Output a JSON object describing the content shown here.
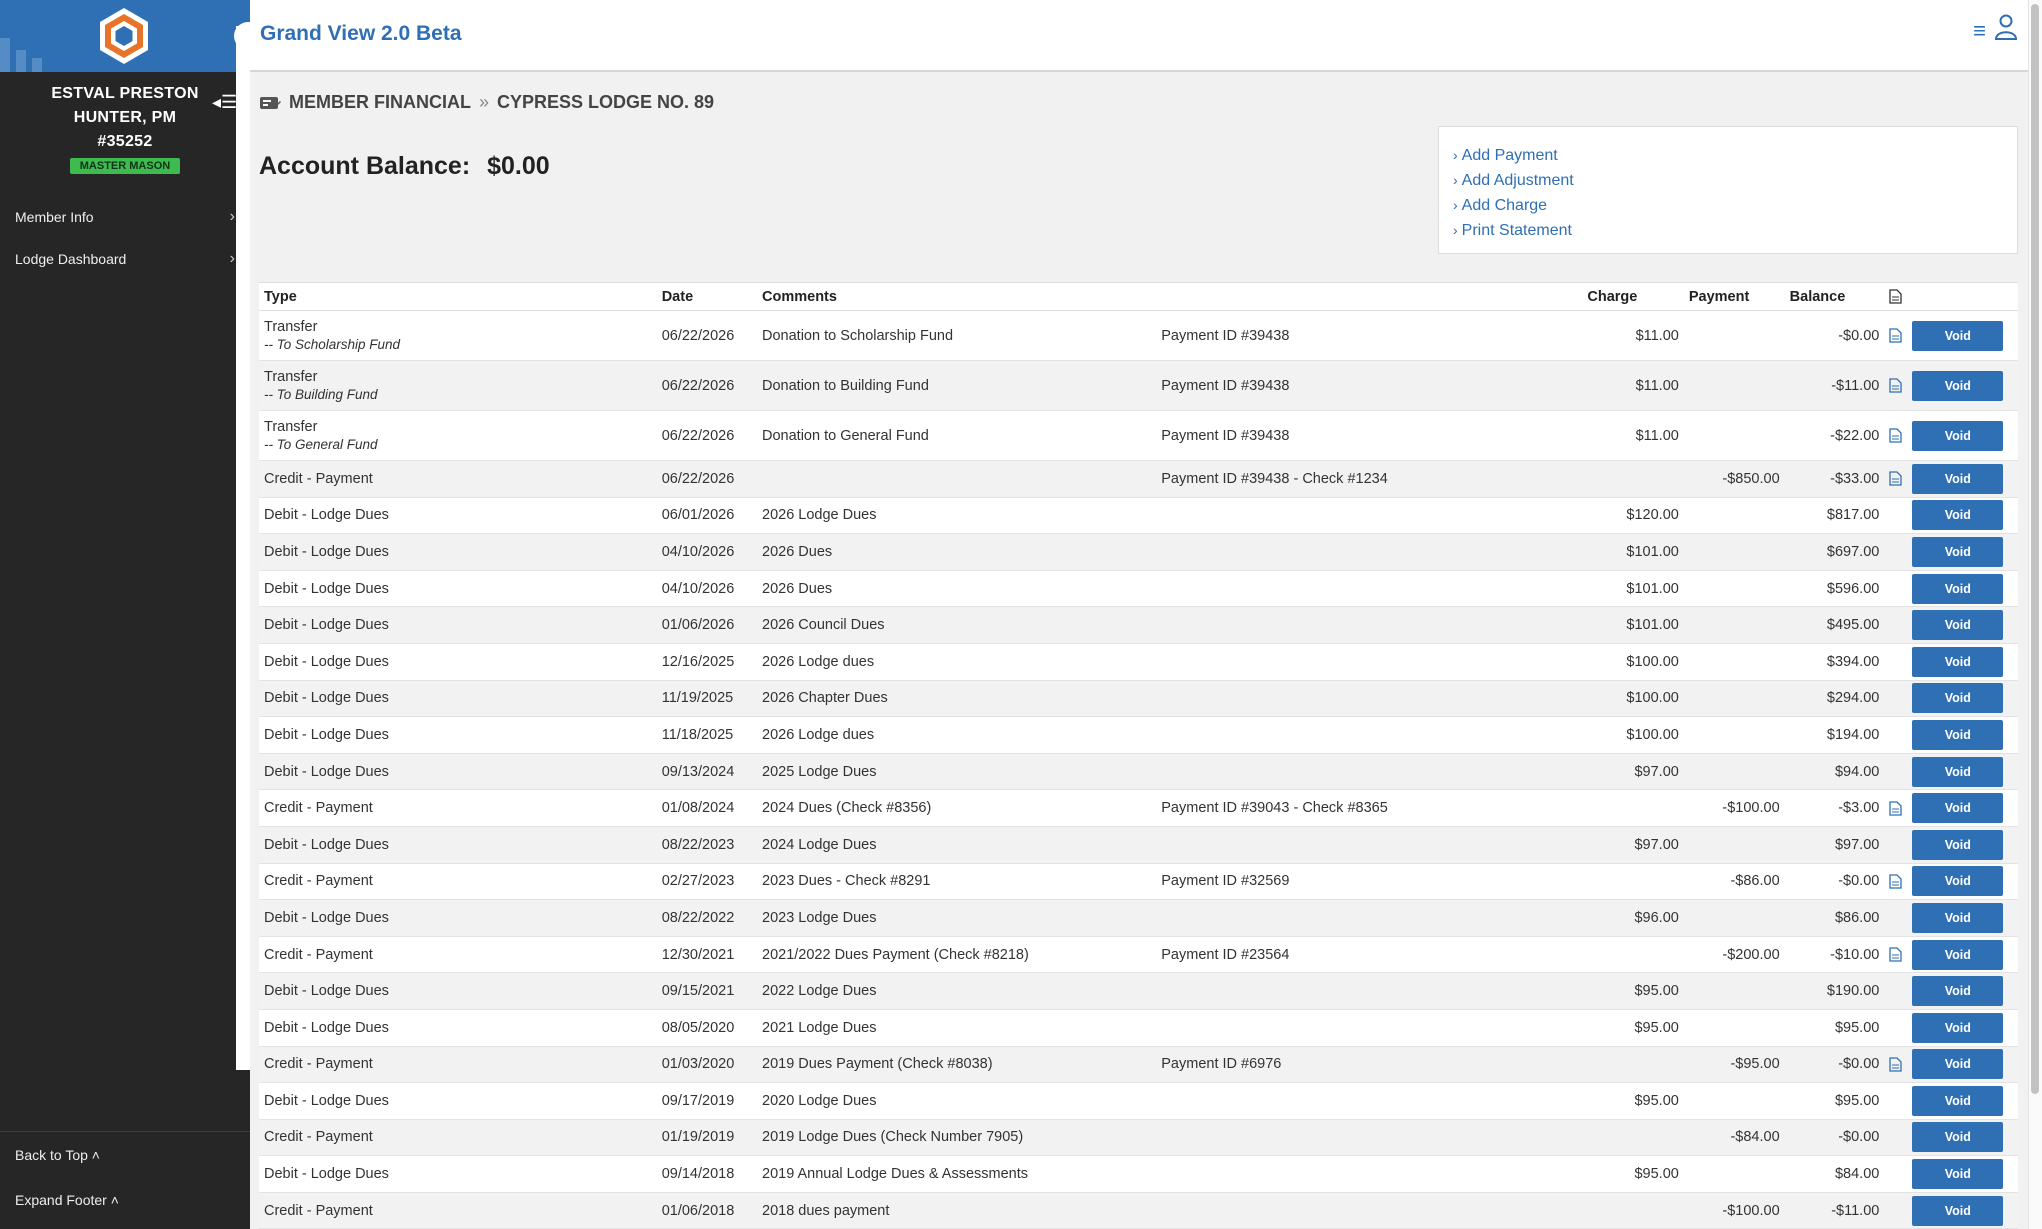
{
  "app": {
    "title": "Grand View 2.0 Beta"
  },
  "member": {
    "name_line1": "ESTVAL PRESTON",
    "name_line2": "HUNTER, PM",
    "id": "#35252",
    "badge": "MASTER MASON"
  },
  "sidebar": {
    "items": [
      {
        "label": "Member Info"
      },
      {
        "label": "Lodge Dashboard"
      }
    ],
    "footer": {
      "back_to_top": "Back to Top",
      "expand_footer": "Expand Footer"
    }
  },
  "breadcrumb": {
    "section": "MEMBER FINANCIAL",
    "lodge": "CYPRESS LODGE NO. 89"
  },
  "account": {
    "label": "Account Balance:",
    "amount": "$0.00"
  },
  "actions": {
    "add_payment": "Add Payment",
    "add_adjustment": "Add Adjustment",
    "add_charge": "Add Charge",
    "print_statement": "Print Statement"
  },
  "table": {
    "headers": {
      "type": "Type",
      "date": "Date",
      "comments": "Comments",
      "charge": "Charge",
      "payment": "Payment",
      "balance": "Balance"
    },
    "void_label": "Void",
    "rows": [
      {
        "type": "Transfer",
        "sub": "-- To Scholarship Fund",
        "date": "06/22/2026",
        "comment": "Donation to Scholarship Fund",
        "ref": "Payment ID #39438",
        "charge": "$11.00",
        "payment": "",
        "balance": "-$0.00",
        "doc": true
      },
      {
        "type": "Transfer",
        "sub": "-- To Building Fund",
        "date": "06/22/2026",
        "comment": "Donation to Building Fund",
        "ref": "Payment ID #39438",
        "charge": "$11.00",
        "payment": "",
        "balance": "-$11.00",
        "doc": true
      },
      {
        "type": "Transfer",
        "sub": "-- To General Fund",
        "date": "06/22/2026",
        "comment": "Donation to General Fund",
        "ref": "Payment ID #39438",
        "charge": "$11.00",
        "payment": "",
        "balance": "-$22.00",
        "doc": true
      },
      {
        "type": "Credit - Payment",
        "sub": "",
        "date": "06/22/2026",
        "comment": "",
        "ref": "Payment ID #39438 - Check #1234",
        "charge": "",
        "payment": "-$850.00",
        "balance": "-$33.00",
        "doc": true
      },
      {
        "type": "Debit - Lodge Dues",
        "sub": "",
        "date": "06/01/2026",
        "comment": "2026 Lodge Dues",
        "ref": "",
        "charge": "$120.00",
        "payment": "",
        "balance": "$817.00",
        "doc": false
      },
      {
        "type": "Debit - Lodge Dues",
        "sub": "",
        "date": "04/10/2026",
        "comment": "2026 Dues",
        "ref": "",
        "charge": "$101.00",
        "payment": "",
        "balance": "$697.00",
        "doc": false
      },
      {
        "type": "Debit - Lodge Dues",
        "sub": "",
        "date": "04/10/2026",
        "comment": "2026 Dues",
        "ref": "",
        "charge": "$101.00",
        "payment": "",
        "balance": "$596.00",
        "doc": false
      },
      {
        "type": "Debit - Lodge Dues",
        "sub": "",
        "date": "01/06/2026",
        "comment": "2026 Council Dues",
        "ref": "",
        "charge": "$101.00",
        "payment": "",
        "balance": "$495.00",
        "doc": false
      },
      {
        "type": "Debit - Lodge Dues",
        "sub": "",
        "date": "12/16/2025",
        "comment": "2026 Lodge dues",
        "ref": "",
        "charge": "$100.00",
        "payment": "",
        "balance": "$394.00",
        "doc": false
      },
      {
        "type": "Debit - Lodge Dues",
        "sub": "",
        "date": "11/19/2025",
        "comment": "2026 Chapter Dues",
        "ref": "",
        "charge": "$100.00",
        "payment": "",
        "balance": "$294.00",
        "doc": false
      },
      {
        "type": "Debit - Lodge Dues",
        "sub": "",
        "date": "11/18/2025",
        "comment": "2026 Lodge dues",
        "ref": "",
        "charge": "$100.00",
        "payment": "",
        "balance": "$194.00",
        "doc": false
      },
      {
        "type": "Debit - Lodge Dues",
        "sub": "",
        "date": "09/13/2024",
        "comment": "2025 Lodge Dues",
        "ref": "",
        "charge": "$97.00",
        "payment": "",
        "balance": "$94.00",
        "doc": false
      },
      {
        "type": "Credit - Payment",
        "sub": "",
        "date": "01/08/2024",
        "comment": "2024 Dues (Check #8356)",
        "ref": "Payment ID #39043 - Check #8365",
        "charge": "",
        "payment": "-$100.00",
        "balance": "-$3.00",
        "doc": true
      },
      {
        "type": "Debit - Lodge Dues",
        "sub": "",
        "date": "08/22/2023",
        "comment": "2024 Lodge Dues",
        "ref": "",
        "charge": "$97.00",
        "payment": "",
        "balance": "$97.00",
        "doc": false
      },
      {
        "type": "Credit - Payment",
        "sub": "",
        "date": "02/27/2023",
        "comment": "2023 Dues - Check #8291",
        "ref": "Payment ID #32569",
        "charge": "",
        "payment": "-$86.00",
        "balance": "-$0.00",
        "doc": true
      },
      {
        "type": "Debit - Lodge Dues",
        "sub": "",
        "date": "08/22/2022",
        "comment": "2023 Lodge Dues",
        "ref": "",
        "charge": "$96.00",
        "payment": "",
        "balance": "$86.00",
        "doc": false
      },
      {
        "type": "Credit - Payment",
        "sub": "",
        "date": "12/30/2021",
        "comment": "2021/2022 Dues Payment (Check #8218)",
        "ref": "Payment ID #23564",
        "charge": "",
        "payment": "-$200.00",
        "balance": "-$10.00",
        "doc": true
      },
      {
        "type": "Debit - Lodge Dues",
        "sub": "",
        "date": "09/15/2021",
        "comment": "2022 Lodge Dues",
        "ref": "",
        "charge": "$95.00",
        "payment": "",
        "balance": "$190.00",
        "doc": false
      },
      {
        "type": "Debit - Lodge Dues",
        "sub": "",
        "date": "08/05/2020",
        "comment": "2021 Lodge Dues",
        "ref": "",
        "charge": "$95.00",
        "payment": "",
        "balance": "$95.00",
        "doc": false
      },
      {
        "type": "Credit - Payment",
        "sub": "",
        "date": "01/03/2020",
        "comment": "2019 Dues Payment (Check #8038)",
        "ref": "Payment ID #6976",
        "charge": "",
        "payment": "-$95.00",
        "balance": "-$0.00",
        "doc": true
      },
      {
        "type": "Debit - Lodge Dues",
        "sub": "",
        "date": "09/17/2019",
        "comment": "2020 Lodge Dues",
        "ref": "",
        "charge": "$95.00",
        "payment": "",
        "balance": "$95.00",
        "doc": false
      },
      {
        "type": "Credit - Payment",
        "sub": "",
        "date": "01/19/2019",
        "comment": "2019 Lodge Dues (Check Number 7905)",
        "ref": "",
        "charge": "",
        "payment": "-$84.00",
        "balance": "-$0.00",
        "doc": false
      },
      {
        "type": "Debit - Lodge Dues",
        "sub": "",
        "date": "09/14/2018",
        "comment": "2019 Annual Lodge Dues & Assessments",
        "ref": "",
        "charge": "$95.00",
        "payment": "",
        "balance": "$84.00",
        "doc": false
      },
      {
        "type": "Credit - Payment",
        "sub": "",
        "date": "01/06/2018",
        "comment": "2018 dues payment",
        "ref": "",
        "charge": "",
        "payment": "-$100.00",
        "balance": "-$11.00",
        "doc": false
      }
    ]
  },
  "colors": {
    "brand": "#2f6fb3",
    "sidebar_bg": "#262626",
    "badge": "#3dbb4f",
    "logo_orange": "#e8742a"
  }
}
